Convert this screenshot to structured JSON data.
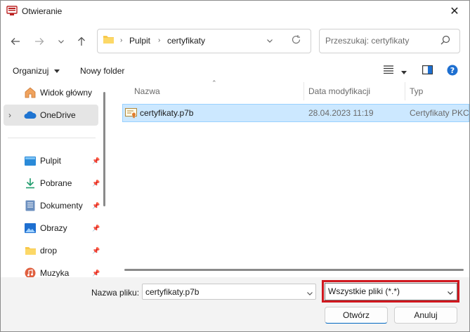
{
  "window": {
    "title": "Otwieranie"
  },
  "nav": {
    "breadcrumb": [
      "Pulpit",
      "certyfikaty"
    ],
    "search_placeholder": "Przeszukaj: certyfikaty"
  },
  "toolbar": {
    "organize_label": "Organizuj",
    "new_folder_label": "Nowy folder"
  },
  "sidebar": {
    "items": [
      {
        "label": "Widok główny",
        "icon": "home-icon",
        "pinned": false,
        "selected": false
      },
      {
        "label": "OneDrive",
        "icon": "cloud-icon",
        "pinned": false,
        "selected": true
      },
      {
        "label": "Pulpit",
        "icon": "desktop-icon",
        "pinned": true,
        "selected": false
      },
      {
        "label": "Pobrane",
        "icon": "download-icon",
        "pinned": true,
        "selected": false
      },
      {
        "label": "Dokumenty",
        "icon": "document-icon",
        "pinned": true,
        "selected": false
      },
      {
        "label": "Obrazy",
        "icon": "image-icon",
        "pinned": true,
        "selected": false
      },
      {
        "label": "drop",
        "icon": "folder-icon",
        "pinned": true,
        "selected": false
      },
      {
        "label": "Muzyka",
        "icon": "music-icon",
        "pinned": true,
        "selected": false
      }
    ]
  },
  "files": {
    "columns": [
      "Nazwa",
      "Data modyfikacji",
      "Typ"
    ],
    "rows": [
      {
        "name": "certyfikaty.p7b",
        "modified": "28.04.2023 11:19",
        "type": "Certyfikaty PKCS"
      }
    ]
  },
  "bottom": {
    "filename_label": "Nazwa pliku:",
    "filename_value": "certyfikaty.p7b",
    "filter_value": "Wszystkie pliki (*.*)",
    "open_label": "Otwórz",
    "cancel_label": "Anuluj"
  },
  "colors": {
    "selection": "#cce8ff",
    "highlight_border": "#d0171e",
    "accent": "#0067c0"
  }
}
